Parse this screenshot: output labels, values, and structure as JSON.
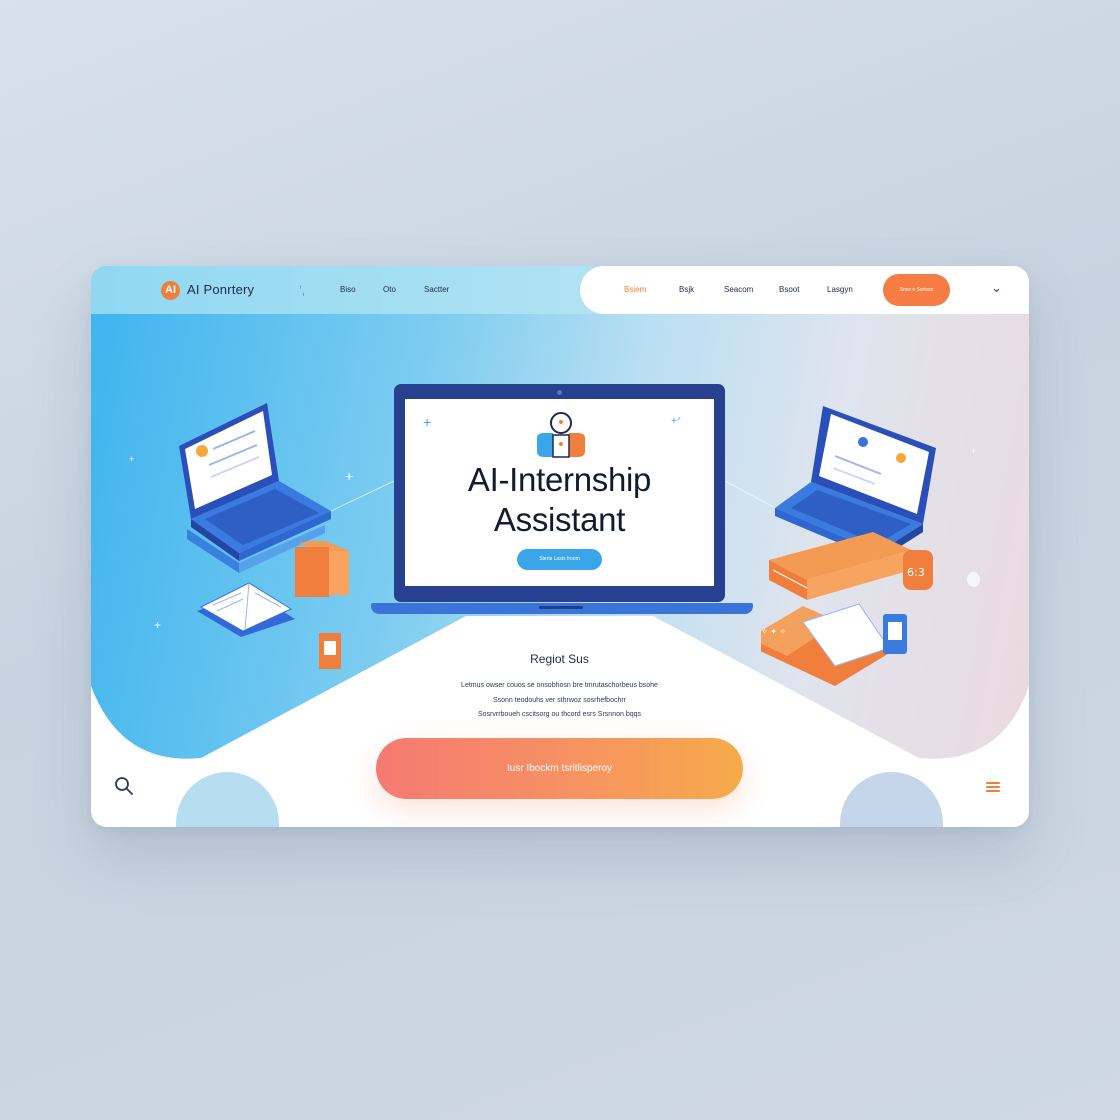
{
  "nav": {
    "logo_initials": "AI",
    "logo_text": "AI Ponrtery",
    "links": [
      "Biso",
      "Oto",
      "Sactter"
    ],
    "pill_links": [
      "Bsiem",
      "Bsjk",
      "Seacom",
      "Bsoot",
      "Lasgyn"
    ],
    "active_link_index": 0,
    "cta_label": "Snos n Ssrtosn"
  },
  "hero": {
    "title_line1": "AI-Internship",
    "title_line2": "Assistant",
    "monitor_button": "Sterts Lasts froom"
  },
  "section": {
    "title": "Regiot Sus",
    "paragraph_lines": [
      "Letmus owser couos se onsobhosn bre tmrutaschorbeus bsohe",
      "Ssonn teodouhs ver sthrwoz sosrhefbochrr",
      "Sosrvrrboueh cscitsorg ou thcord esrs Srsnnon bqqs"
    ],
    "cta_label": "Iusr Ibockm tsritlisperoy"
  },
  "colors": {
    "accent_orange": "#f57c43",
    "accent_blue": "#3ba5ea",
    "navy": "#27408f"
  },
  "icons": {
    "search": "search-icon",
    "menu": "hamburger-menu-icon",
    "chevron": "chevron-down-icon"
  }
}
